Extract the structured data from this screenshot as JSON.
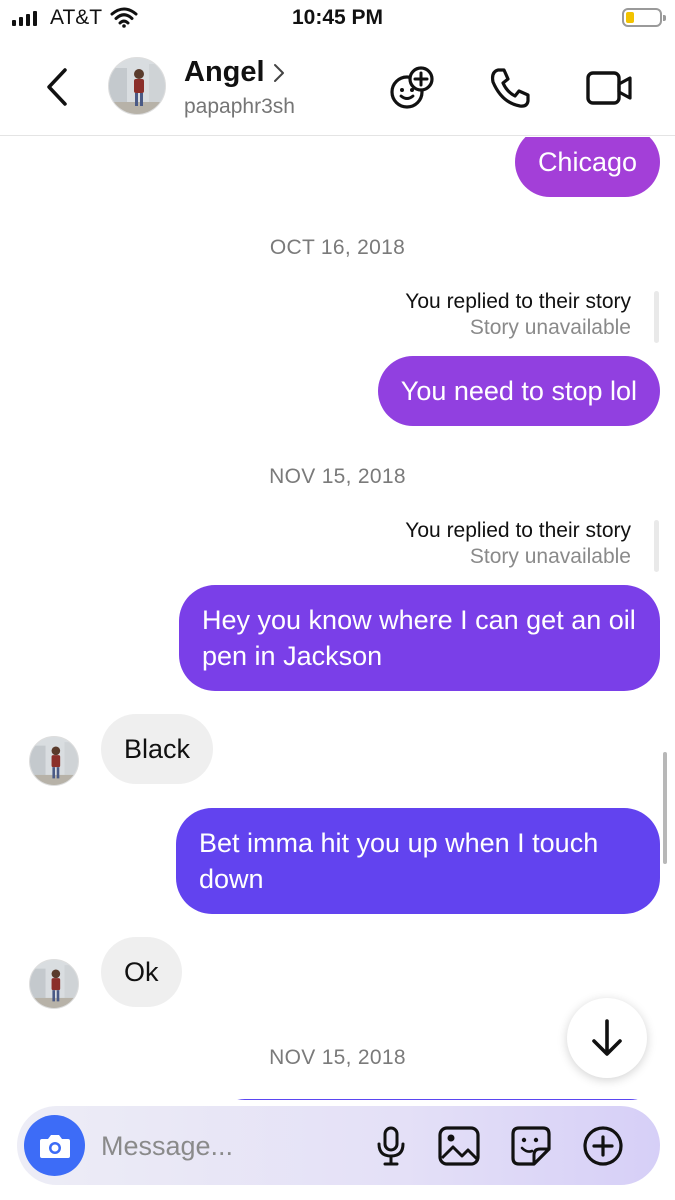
{
  "status_bar": {
    "carrier": "AT&T",
    "time": "10:45 PM",
    "battery_level": 0.2,
    "battery_color": "#f2c300"
  },
  "header": {
    "back_icon": "chevron-left-icon",
    "contact_name": "Angel",
    "contact_handle": "papaphr3sh",
    "actions": [
      "sticker-add-icon",
      "phone-icon",
      "video-camera-icon"
    ]
  },
  "thread": {
    "messages": [
      {
        "type": "outgoing",
        "text": "Chicago",
        "color": "#a33fd8"
      },
      {
        "type": "date",
        "text": "OCT 16, 2018"
      },
      {
        "type": "story_reply",
        "title": "You replied to their story",
        "subtitle": "Story unavailable"
      },
      {
        "type": "outgoing",
        "text": "You need to stop lol",
        "color": "#9140e0"
      },
      {
        "type": "date",
        "text": "NOV 15, 2018"
      },
      {
        "type": "story_reply",
        "title": "You replied to their story",
        "subtitle": "Story unavailable"
      },
      {
        "type": "outgoing",
        "text": "Hey you know where I can get an oil pen in Jackson",
        "color": "#7a3fe8"
      },
      {
        "type": "incoming",
        "text": "Black"
      },
      {
        "type": "outgoing",
        "text": "Bet imma hit you up when I touch down",
        "color": "#6243ef"
      },
      {
        "type": "incoming",
        "text": "Ok"
      },
      {
        "type": "date",
        "text": "NOV 15, 2018"
      }
    ]
  },
  "composer": {
    "placeholder": "Message...",
    "icons": [
      "camera-icon",
      "microphone-icon",
      "gallery-icon",
      "sticker-icon",
      "plus-icon"
    ]
  },
  "colors": {
    "camera_button": "#3d6cf7",
    "incoming_bubble": "#efefef"
  }
}
